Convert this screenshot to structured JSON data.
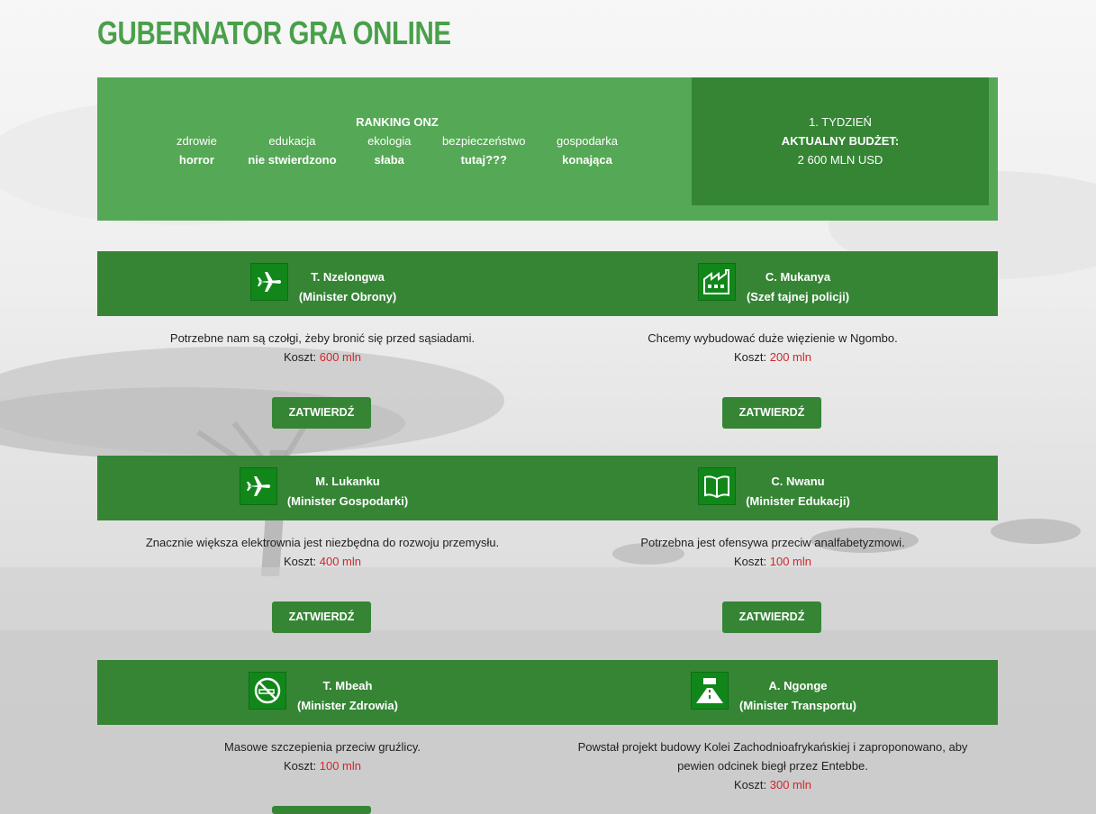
{
  "title": "GUBERNATOR GRA ONLINE",
  "colors": {
    "brand_green": "#4aa04a",
    "banner_green": "#55a855",
    "dark_green": "#358535",
    "icon_green": "#11871a",
    "cost_red": "#d0282c"
  },
  "ranking": {
    "title": "RANKING ONZ",
    "categories": [
      {
        "label": "zdrowie",
        "value": "horror"
      },
      {
        "label": "edukacja",
        "value": "nie stwierdzono"
      },
      {
        "label": "ekologia",
        "value": "słaba"
      },
      {
        "label": "bezpieczeństwo",
        "value": "tutaj???"
      },
      {
        "label": "gospodarka",
        "value": "konająca"
      }
    ]
  },
  "budget": {
    "week": "1. TYDZIEŃ",
    "label": "AKTUALNY BUDŻET:",
    "value": "2 600 MLN USD"
  },
  "cost_label": "Koszt:",
  "approve_label": "ZATWIERDŹ",
  "proposals": [
    {
      "name": "T. Nzelongwa",
      "role": "(Minister Obrony)",
      "icon": "airplane-icon",
      "text": "Potrzebne nam są czołgi, żeby bronić się przed sąsiadami.",
      "cost": "600 mln"
    },
    {
      "name": "C. Mukanya",
      "role": "(Szef tajnej policji)",
      "icon": "factory-icon",
      "text": "Chcemy wybudować duże więzienie w Ngombo.",
      "cost": "200 mln"
    },
    {
      "name": "M. Lukanku",
      "role": "(Minister Gospodarki)",
      "icon": "airplane-icon",
      "text": "Znacznie większa elektrownia jest niezbędna do rozwoju przemysłu.",
      "cost": "400 mln"
    },
    {
      "name": "C. Nwanu",
      "role": "(Minister Edukacji)",
      "icon": "book-icon",
      "text": "Potrzebna jest ofensywa przeciw analfabetyzmowi.",
      "cost": "100 mln"
    },
    {
      "name": "T. Mbeah",
      "role": "(Minister Zdrowia)",
      "icon": "no-smoking-icon",
      "text": "Masowe szczepienia przeciw gruźlicy.",
      "cost": "100 mln"
    },
    {
      "name": "A. Ngonge",
      "role": "(Minister Transportu)",
      "icon": "road-icon",
      "text_line1": "Powstał projekt budowy Kolei Zachodnioafrykańskiej i zaproponowano, aby",
      "text_line2": "pewien odcinek biegł przez Entebbe.",
      "cost": "300 mln"
    }
  ]
}
